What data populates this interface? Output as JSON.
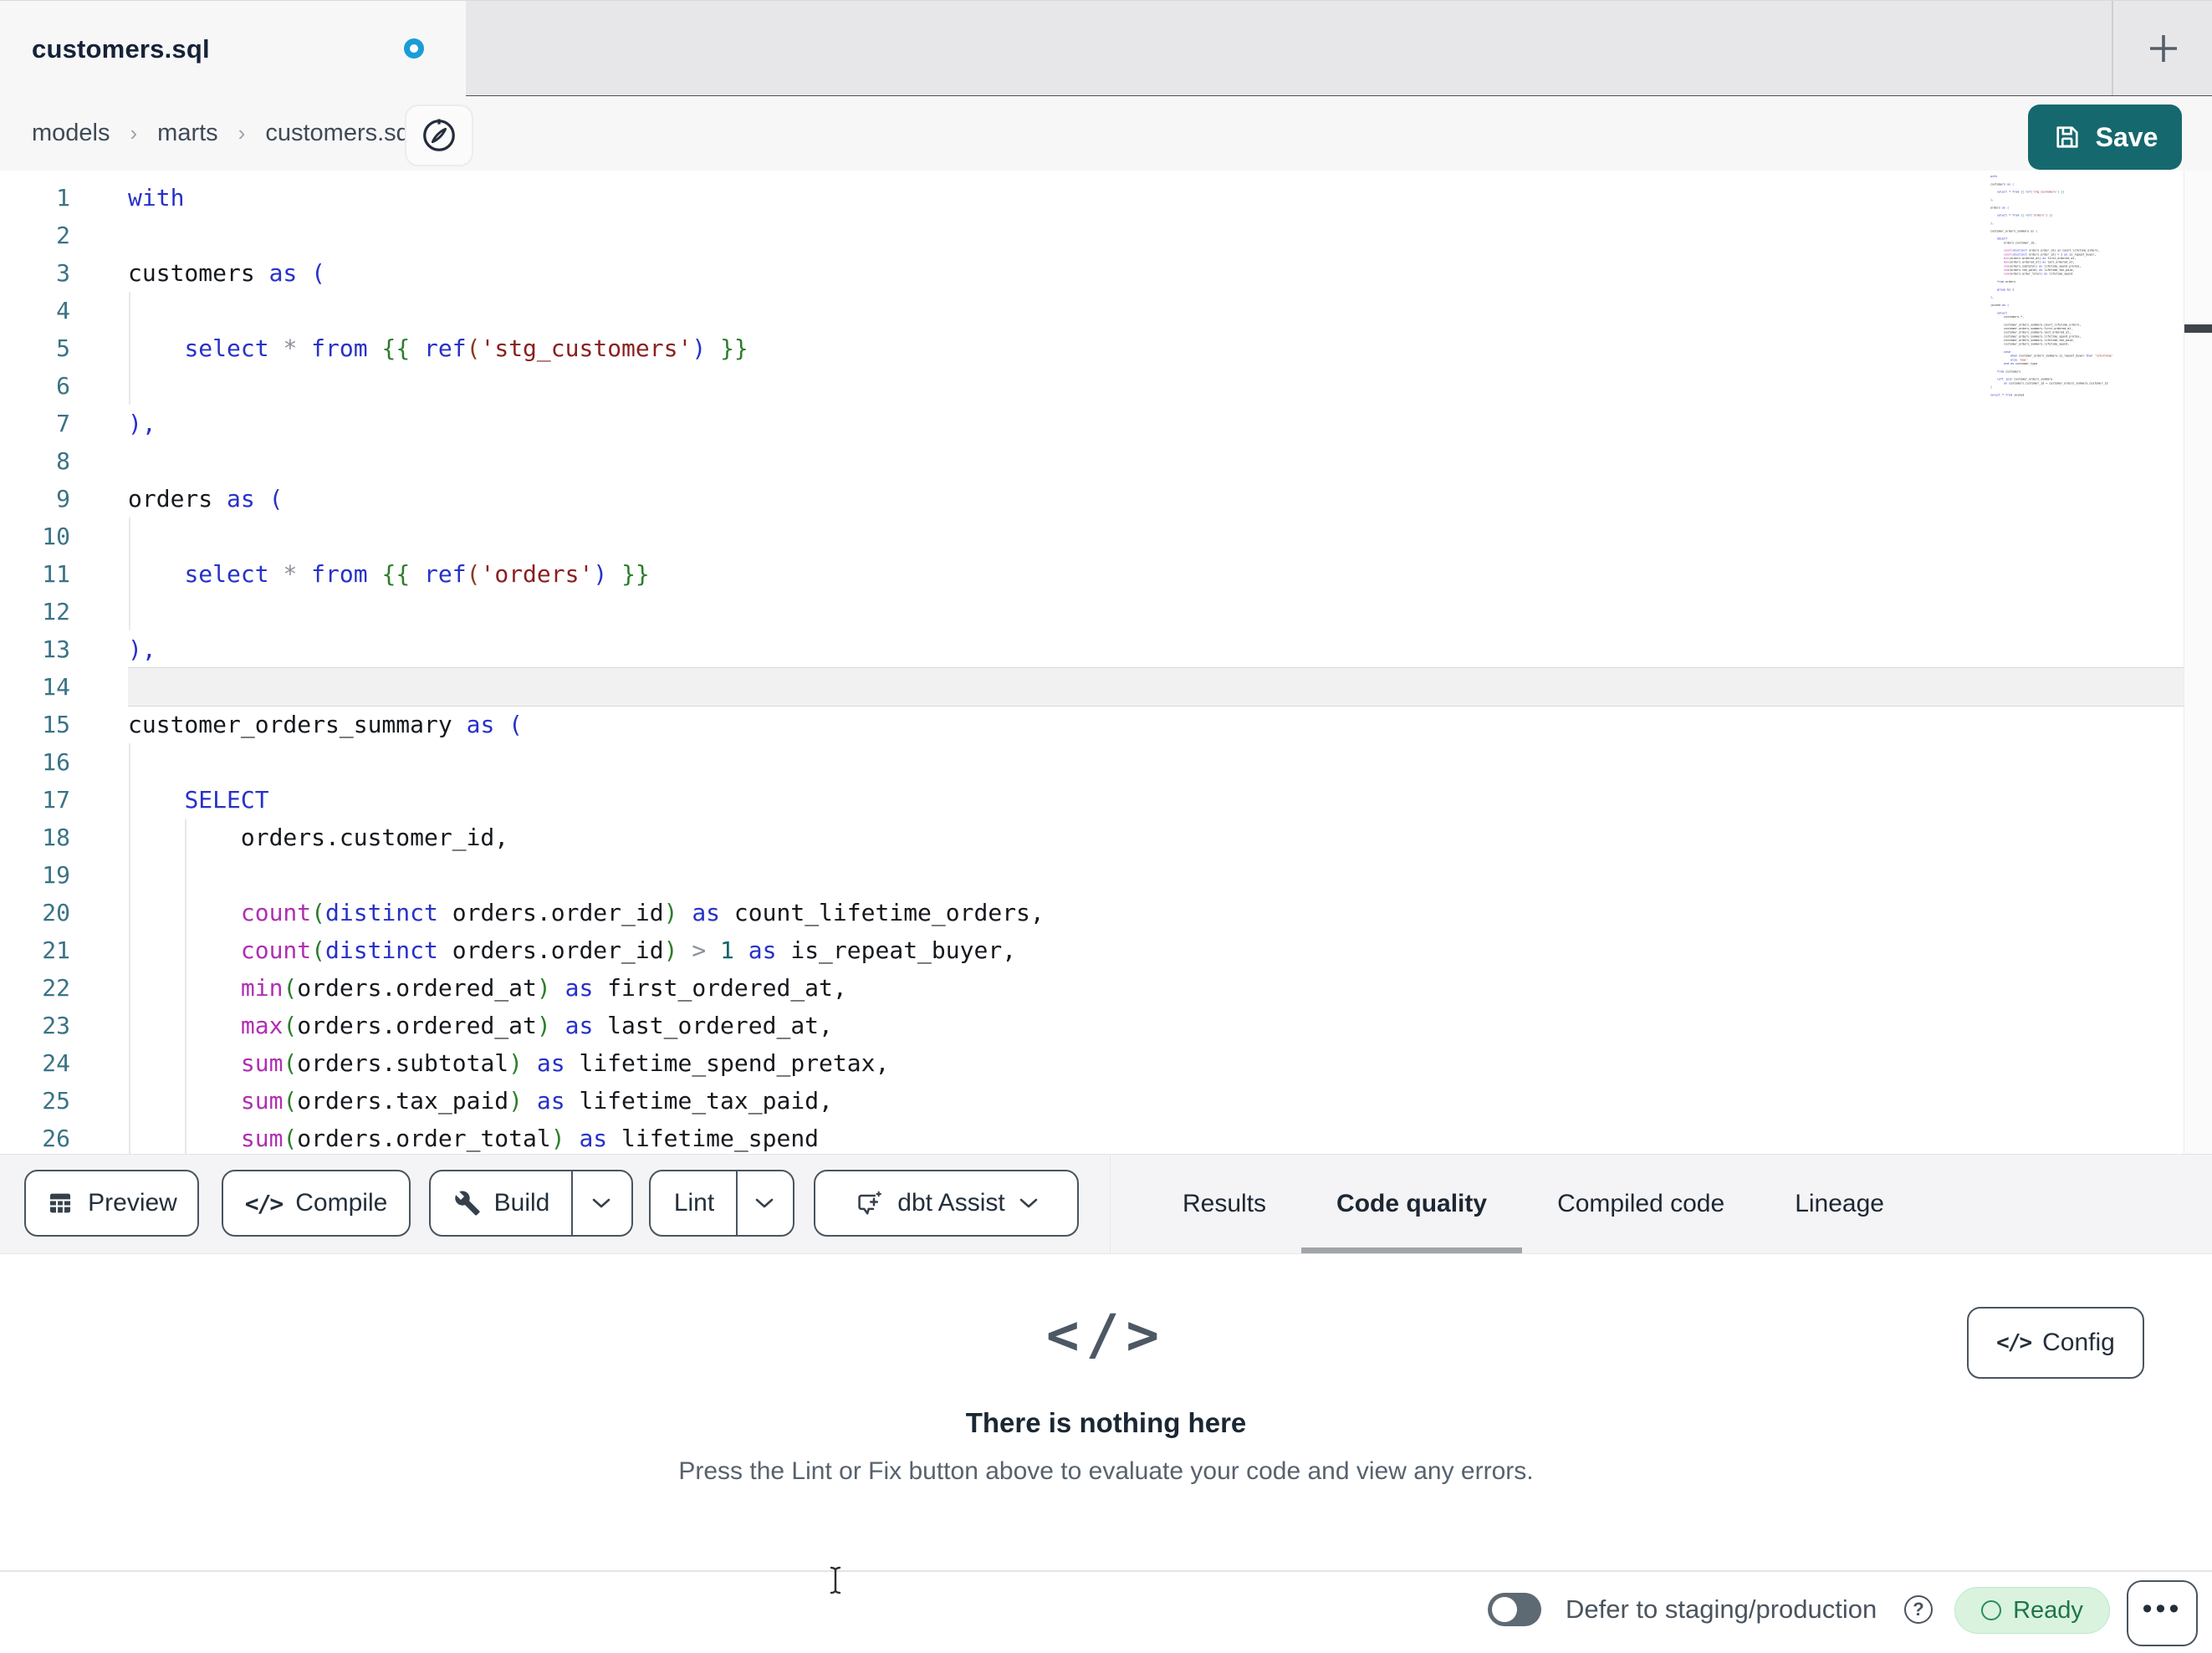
{
  "window": {
    "tab_title": "customers.sql",
    "new_tab_label": "+",
    "unsaved": true
  },
  "breadcrumb": {
    "items": [
      "models",
      "marts",
      "customers.sql"
    ],
    "separator": "›"
  },
  "save_button": {
    "label": "Save"
  },
  "editor": {
    "active_line": 14,
    "lines": [
      {
        "n": 1,
        "t": [
          [
            "kw",
            "with"
          ]
        ]
      },
      {
        "n": 2,
        "t": []
      },
      {
        "n": 3,
        "t": [
          [
            "id",
            "customers"
          ],
          [
            "sp",
            " "
          ],
          [
            "kw",
            "as"
          ],
          [
            "sp",
            " "
          ],
          [
            "kw",
            "("
          ]
        ]
      },
      {
        "n": 4,
        "t": []
      },
      {
        "n": 5,
        "t": [
          [
            "sp",
            "    "
          ],
          [
            "kw",
            "select"
          ],
          [
            "sp",
            " "
          ],
          [
            "op",
            "*"
          ],
          [
            "sp",
            " "
          ],
          [
            "kw",
            "from"
          ],
          [
            "sp",
            " "
          ],
          [
            "br",
            "{{"
          ],
          [
            "sp",
            " "
          ],
          [
            "kw",
            "ref"
          ],
          [
            "parb",
            "("
          ],
          [
            "str",
            "'stg_customers'"
          ],
          [
            "cp",
            ")"
          ],
          [
            "sp",
            " "
          ],
          [
            "br",
            "}}"
          ]
        ]
      },
      {
        "n": 6,
        "t": []
      },
      {
        "n": 7,
        "t": [
          [
            "kw",
            "),"
          ]
        ]
      },
      {
        "n": 8,
        "t": []
      },
      {
        "n": 9,
        "t": [
          [
            "id",
            "orders"
          ],
          [
            "sp",
            " "
          ],
          [
            "kw",
            "as"
          ],
          [
            "sp",
            " "
          ],
          [
            "kw",
            "("
          ]
        ]
      },
      {
        "n": 10,
        "t": []
      },
      {
        "n": 11,
        "t": [
          [
            "sp",
            "    "
          ],
          [
            "kw",
            "select"
          ],
          [
            "sp",
            " "
          ],
          [
            "op",
            "*"
          ],
          [
            "sp",
            " "
          ],
          [
            "kw",
            "from"
          ],
          [
            "sp",
            " "
          ],
          [
            "br",
            "{{"
          ],
          [
            "sp",
            " "
          ],
          [
            "kw",
            "ref"
          ],
          [
            "parb",
            "("
          ],
          [
            "str",
            "'orders'"
          ],
          [
            "cp",
            ")"
          ],
          [
            "sp",
            " "
          ],
          [
            "br",
            "}}"
          ]
        ]
      },
      {
        "n": 12,
        "t": []
      },
      {
        "n": 13,
        "t": [
          [
            "kw",
            "),"
          ]
        ]
      },
      {
        "n": 14,
        "t": []
      },
      {
        "n": 15,
        "t": [
          [
            "id",
            "customer_orders_summary"
          ],
          [
            "sp",
            " "
          ],
          [
            "kw",
            "as"
          ],
          [
            "sp",
            " "
          ],
          [
            "kw",
            "("
          ]
        ]
      },
      {
        "n": 16,
        "t": []
      },
      {
        "n": 17,
        "t": [
          [
            "sp",
            "    "
          ],
          [
            "kw",
            "SELECT"
          ]
        ]
      },
      {
        "n": 18,
        "t": [
          [
            "sp",
            "        "
          ],
          [
            "id",
            "orders.customer_id,"
          ]
        ]
      },
      {
        "n": 19,
        "t": []
      },
      {
        "n": 20,
        "t": [
          [
            "sp",
            "        "
          ],
          [
            "fn",
            "count"
          ],
          [
            "par",
            "("
          ],
          [
            "kw",
            "distinct"
          ],
          [
            "sp",
            " "
          ],
          [
            "id",
            "orders.order_id"
          ],
          [
            "par",
            ")"
          ],
          [
            "sp",
            " "
          ],
          [
            "kw",
            "as"
          ],
          [
            "sp",
            " "
          ],
          [
            "id",
            "count_lifetime_orders,"
          ]
        ]
      },
      {
        "n": 21,
        "t": [
          [
            "sp",
            "        "
          ],
          [
            "fn",
            "count"
          ],
          [
            "par",
            "("
          ],
          [
            "kw",
            "distinct"
          ],
          [
            "sp",
            " "
          ],
          [
            "id",
            "orders.order_id"
          ],
          [
            "par",
            ")"
          ],
          [
            "sp",
            " "
          ],
          [
            "op",
            ">"
          ],
          [
            "sp",
            " "
          ],
          [
            "num",
            "1"
          ],
          [
            "sp",
            " "
          ],
          [
            "kw",
            "as"
          ],
          [
            "sp",
            " "
          ],
          [
            "id",
            "is_repeat_buyer,"
          ]
        ]
      },
      {
        "n": 22,
        "t": [
          [
            "sp",
            "        "
          ],
          [
            "fn",
            "min"
          ],
          [
            "par",
            "("
          ],
          [
            "id",
            "orders.ordered_at"
          ],
          [
            "par",
            ")"
          ],
          [
            "sp",
            " "
          ],
          [
            "kw",
            "as"
          ],
          [
            "sp",
            " "
          ],
          [
            "id",
            "first_ordered_at,"
          ]
        ]
      },
      {
        "n": 23,
        "t": [
          [
            "sp",
            "        "
          ],
          [
            "fn",
            "max"
          ],
          [
            "par",
            "("
          ],
          [
            "id",
            "orders.ordered_at"
          ],
          [
            "par",
            ")"
          ],
          [
            "sp",
            " "
          ],
          [
            "kw",
            "as"
          ],
          [
            "sp",
            " "
          ],
          [
            "id",
            "last_ordered_at,"
          ]
        ]
      },
      {
        "n": 24,
        "t": [
          [
            "sp",
            "        "
          ],
          [
            "fn",
            "sum"
          ],
          [
            "par",
            "("
          ],
          [
            "id",
            "orders.subtotal"
          ],
          [
            "par",
            ")"
          ],
          [
            "sp",
            " "
          ],
          [
            "kw",
            "as"
          ],
          [
            "sp",
            " "
          ],
          [
            "id",
            "lifetime_spend_pretax,"
          ]
        ]
      },
      {
        "n": 25,
        "t": [
          [
            "sp",
            "        "
          ],
          [
            "fn",
            "sum"
          ],
          [
            "par",
            "("
          ],
          [
            "id",
            "orders.tax_paid"
          ],
          [
            "par",
            ")"
          ],
          [
            "sp",
            " "
          ],
          [
            "kw",
            "as"
          ],
          [
            "sp",
            " "
          ],
          [
            "id",
            "lifetime_tax_paid,"
          ]
        ]
      },
      {
        "n": 26,
        "t": [
          [
            "sp",
            "        "
          ],
          [
            "fn",
            "sum"
          ],
          [
            "par",
            "("
          ],
          [
            "id",
            "orders.order_total"
          ],
          [
            "par",
            ")"
          ],
          [
            "sp",
            " "
          ],
          [
            "kw",
            "as"
          ],
          [
            "sp",
            " "
          ],
          [
            "id",
            "lifetime_spend"
          ]
        ]
      }
    ]
  },
  "minimap": {
    "lines": [
      "with",
      "",
      "customers as (",
      "",
      "    select * from {{ ref('stg_customers') }}",
      "",
      "),",
      "",
      "orders as (",
      "",
      "    select * from {{ ref('orders') }}",
      "",
      "),",
      "",
      "customer_orders_summary as (",
      "",
      "    SELECT",
      "        orders.customer_id,",
      "",
      "        count(distinct orders.order_id) as count_lifetime_orders,",
      "        count(distinct orders.order_id) > 1 as is_repeat_buyer,",
      "        min(orders.ordered_at) as first_ordered_at,",
      "        max(orders.ordered_at) as last_ordered_at,",
      "        sum(orders.subtotal) as lifetime_spend_pretax,",
      "        sum(orders.tax_paid) as lifetime_tax_paid,",
      "        sum(orders.order_total) as lifetime_spend",
      "",
      "    from orders",
      "",
      "    group by 1",
      "",
      "),",
      "",
      "joined as (",
      "",
      "    select",
      "        customers.*,",
      "",
      "        customer_orders_summary.count_lifetime_orders,",
      "        customer_orders_summary.first_ordered_at,",
      "        customer_orders_summary.last_ordered_at,",
      "        customer_orders_summary.lifetime_spend_pretax,",
      "        customer_orders_summary.lifetime_tax_paid,",
      "        customer_orders_summary.lifetime_spend,",
      "",
      "        case",
      "            when customer_orders_summary.is_repeat_buyer then 'returning'",
      "            else 'new'",
      "        end as customer_type",
      "",
      "    from customers",
      "",
      "    left join customer_orders_summary",
      "        on customers.customer_id = customer_orders_summary.customer_id",
      ")",
      "",
      "select * from joined"
    ]
  },
  "toolbar": {
    "preview_label": "Preview",
    "compile_label": "Compile",
    "build_label": "Build",
    "lint_label": "Lint",
    "assist_label": "dbt Assist"
  },
  "panel_tabs": {
    "items": [
      "Results",
      "Code quality",
      "Compiled code",
      "Lineage"
    ],
    "active": "Code quality"
  },
  "empty_state": {
    "icon": "code-icon",
    "glyph": "</>",
    "title": "There is nothing here",
    "subtitle": "Press the Lint or Fix button above to evaluate your code and view any errors."
  },
  "config_button": {
    "label": "Config",
    "glyph": "</>"
  },
  "status_bar": {
    "defer_label": "Defer to staging/production",
    "defer_toggle_on": false,
    "help_glyph": "?",
    "ready_label": "Ready",
    "more_glyph": "•••"
  },
  "colors": {
    "accent_teal": "#15696e",
    "unsaved_dot": "#1a9cd8",
    "tab_text": "#152238",
    "syntax_keyword": "#2731c8",
    "syntax_function": "#b02fb2",
    "syntax_string": "#8b1f1f",
    "syntax_brace": "#2c7d2c",
    "syntax_paren": "#2c7d2c",
    "syntax_paren_jinja": "#8b3a20",
    "syntax_operator": "#8a9099",
    "syntax_number": "#10646d",
    "syntax_text": "#15181d",
    "gutter_number": "#3a7386",
    "active_tab_underline": "#a2a5a8",
    "ready_bg": "#d9f3de",
    "ready_text": "#20744a"
  }
}
